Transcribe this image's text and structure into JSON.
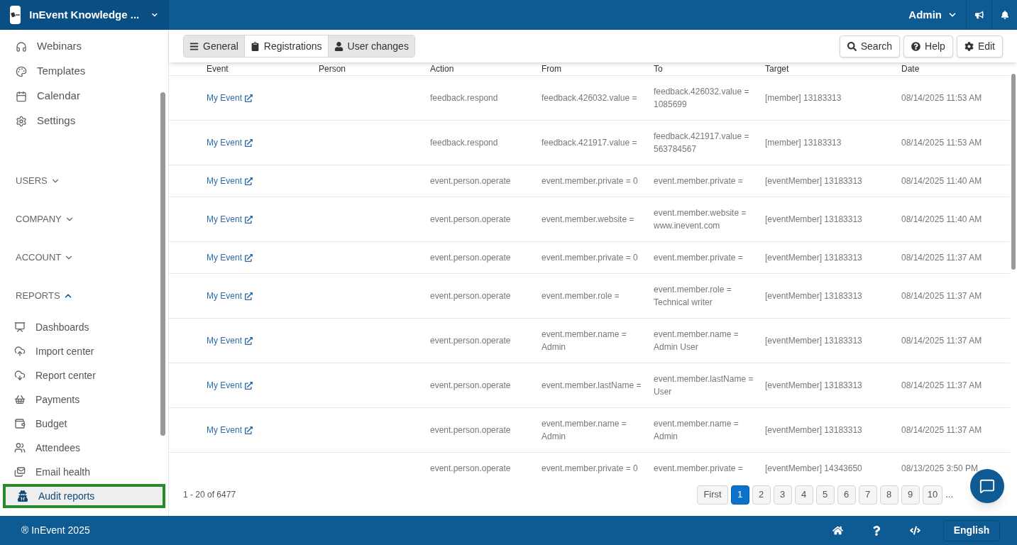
{
  "header": {
    "workspace": "InEvent Knowledge ...",
    "user": "Admin"
  },
  "sidebar": {
    "items": [
      {
        "label": "Webinars"
      },
      {
        "label": "Templates"
      },
      {
        "label": "Calendar"
      },
      {
        "label": "Settings"
      }
    ],
    "sections": [
      {
        "label": "USERS",
        "expanded": false
      },
      {
        "label": "COMPANY",
        "expanded": false
      },
      {
        "label": "ACCOUNT",
        "expanded": false
      },
      {
        "label": "REPORTS",
        "expanded": true,
        "items": [
          {
            "label": "Dashboards",
            "selected": false
          },
          {
            "label": "Import center",
            "selected": false
          },
          {
            "label": "Report center",
            "selected": false
          },
          {
            "label": "Payments",
            "selected": false
          },
          {
            "label": "Budget",
            "selected": false
          },
          {
            "label": "Attendees",
            "selected": false
          },
          {
            "label": "Email health",
            "selected": false
          },
          {
            "label": "Audit reports",
            "selected": true
          }
        ]
      }
    ]
  },
  "tabs": [
    {
      "label": "General",
      "selected": true
    },
    {
      "label": "Registrations",
      "selected": false
    },
    {
      "label": "User changes",
      "selected": true
    }
  ],
  "toolbar": [
    "Search",
    "Help",
    "Edit"
  ],
  "table": {
    "columns": [
      "Event",
      "Person",
      "Action",
      "From",
      "To",
      "Target",
      "Date"
    ],
    "rows": [
      {
        "event": "My Event",
        "action": "feedback.respond",
        "from": "feedback.426032.value =",
        "to": "feedback.426032.value = 1085699",
        "target": "[member] 13183313",
        "date": "08/14/2025 11:53 AM"
      },
      {
        "event": "My Event",
        "action": "feedback.respond",
        "from": "feedback.421917.value =",
        "to": "feedback.421917.value = 563784567",
        "target": "[member] 13183313",
        "date": "08/14/2025 11:53 AM"
      },
      {
        "event": "My Event",
        "action": "event.person.operate",
        "from": "event.member.private = 0",
        "to": "event.member.private =",
        "target": "[eventMember] 13183313",
        "date": "08/14/2025 11:40 AM"
      },
      {
        "event": "My Event",
        "action": "event.person.operate",
        "from": "event.member.website =",
        "to": "event.member.website = www.inevent.com",
        "target": "[eventMember] 13183313",
        "date": "08/14/2025 11:40 AM"
      },
      {
        "event": "My Event",
        "action": "event.person.operate",
        "from": "event.member.private = 0",
        "to": "event.member.private =",
        "target": "[eventMember] 13183313",
        "date": "08/14/2025 11:37 AM"
      },
      {
        "event": "My Event",
        "action": "event.person.operate",
        "from": "event.member.role =",
        "to": "event.member.role = Technical writer",
        "target": "[eventMember] 13183313",
        "date": "08/14/2025 11:37 AM"
      },
      {
        "event": "My Event",
        "action": "event.person.operate",
        "from": "event.member.name = Admin",
        "to": "event.member.name = Admin User",
        "target": "[eventMember] 13183313",
        "date": "08/14/2025 11:37 AM"
      },
      {
        "event": "My Event",
        "action": "event.person.operate",
        "from": "event.member.lastName =",
        "to": "event.member.lastName = User",
        "target": "[eventMember] 13183313",
        "date": "08/14/2025 11:37 AM"
      },
      {
        "event": "My Event",
        "action": "event.person.operate",
        "from": "event.member.name = Admin",
        "to": "event.member.name = Admin",
        "target": "[eventMember] 13183313",
        "date": "08/14/2025 11:37 AM"
      },
      {
        "action": "event.person.operate",
        "from": "event.member.private = 0",
        "to": "event.member.private =",
        "target": "[eventMember] 14343650",
        "date": "08/13/2025 3:50 PM"
      }
    ]
  },
  "pagination": {
    "summary": "1 - 20 of 6477",
    "first": "First",
    "pages": [
      {
        "label": "1",
        "selected": true
      },
      {
        "label": "2",
        "selected": false
      },
      {
        "label": "3",
        "selected": false
      },
      {
        "label": "4",
        "selected": false
      },
      {
        "label": "5",
        "selected": false
      },
      {
        "label": "6",
        "selected": false
      },
      {
        "label": "7",
        "selected": false
      },
      {
        "label": "8",
        "selected": false
      },
      {
        "label": "9",
        "selected": false
      },
      {
        "label": "10",
        "selected": false
      }
    ],
    "ellipsis": "..."
  },
  "footer": {
    "copyright": "® InEvent 2025",
    "language": "English"
  }
}
